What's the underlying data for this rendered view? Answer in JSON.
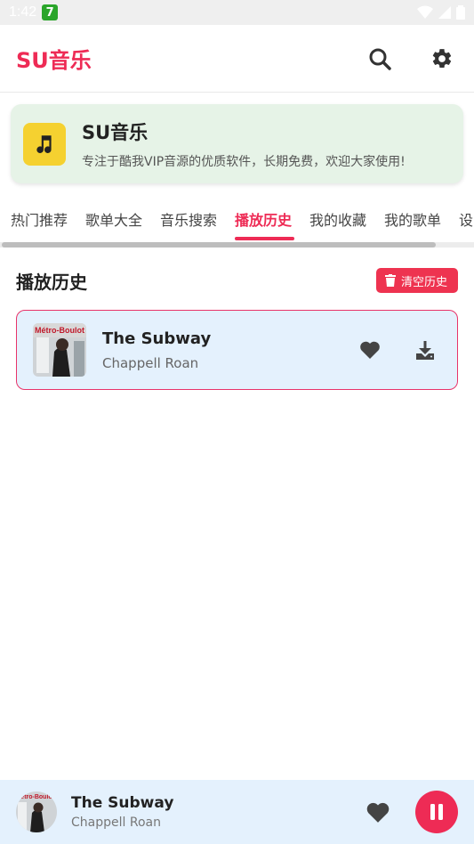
{
  "status": {
    "time": "1:42",
    "badge": "7"
  },
  "appbar": {
    "title": "SU音乐",
    "search_icon": "search-icon",
    "settings_icon": "gear-icon"
  },
  "banner": {
    "title": "SU音乐",
    "subtitle": "专注于酷我VIP音源的优质软件，长期免费，欢迎大家使用!",
    "logo_icon": "music-note-icon"
  },
  "tabs": [
    {
      "label": "热门推荐"
    },
    {
      "label": "歌单大全"
    },
    {
      "label": "音乐搜索"
    },
    {
      "label": "播放历史"
    },
    {
      "label": "我的收藏"
    },
    {
      "label": "我的歌单"
    },
    {
      "label": "设"
    }
  ],
  "active_tab": 3,
  "history": {
    "title": "播放历史",
    "clear_label": "清空历史",
    "items": [
      {
        "title": "The Subway",
        "artist": "Chappell Roan",
        "cover_text": "Métro-Boulot"
      }
    ]
  },
  "player": {
    "title": "The Subway",
    "artist": "Chappell Roan",
    "cover_text": "étro-Boulo"
  },
  "colors": {
    "accent": "#ee2b55",
    "banner_bg": "#e6f3e7",
    "card_bg": "#e4f1fd",
    "logo_bg": "#f5d130"
  }
}
